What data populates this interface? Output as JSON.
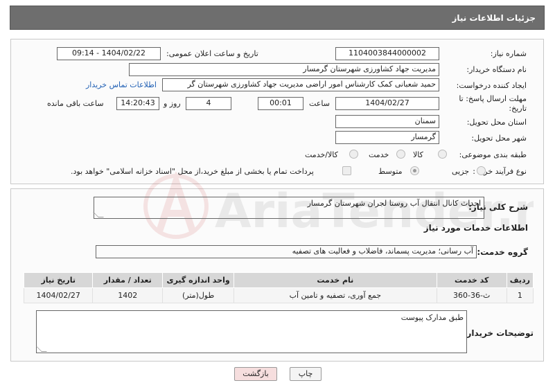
{
  "header": {
    "title": "جزئیات اطلاعات نیاز"
  },
  "form": {
    "need_number": {
      "label": "شماره نیاز:",
      "value": "1104003844000002"
    },
    "announce_datetime": {
      "label": "تاریخ و ساعت اعلان عمومی:",
      "value": "1404/02/22 - 09:14"
    },
    "buyer_org": {
      "label": "نام دستگاه خریدار:",
      "value": "مدیریت جهاد کشاورزی شهرستان گرمسار"
    },
    "requester": {
      "label": "ایجاد کننده درخواست:",
      "value": "حمید شعبانی کمک کارشناس امور اراضی مدیریت جهاد کشاورزی شهرستان گر",
      "contact_link": "اطلاعات تماس خریدار"
    },
    "deadline": {
      "label": "مهلت ارسال پاسخ: تا تاریخ:",
      "date": "1404/02/27",
      "time_label": "ساعت",
      "time": "00:01",
      "days": "4",
      "days_label": "روز و",
      "remaining": "14:20:43",
      "remaining_label": "ساعت باقی مانده"
    },
    "province": {
      "label": "استان محل تحویل:",
      "value": "سمنان"
    },
    "city": {
      "label": "شهر محل تحویل:",
      "value": "گرمسار"
    },
    "category": {
      "label": "طبقه بندی موضوعی:",
      "options": [
        {
          "label": "کالا",
          "selected": false
        },
        {
          "label": "خدمت",
          "selected": false
        },
        {
          "label": "کالا/خدمت",
          "selected": false
        }
      ]
    },
    "purchase_type": {
      "label": "نوع فرآیند خرید :",
      "options": [
        {
          "label": "جزیی",
          "selected": false
        },
        {
          "label": "متوسط",
          "selected": true
        }
      ],
      "payment_note": "پرداخت تمام یا بخشی از مبلغ خرید،از محل \"اسناد خزانه اسلامی\" خواهد بود."
    }
  },
  "details": {
    "general_desc_label": "شرح کلی نیاز:",
    "general_desc": "احداث کانال انتقال آب روستا لجران شهرستان گرمسار",
    "services_title": "اطلاعات خدمات مورد نیاز",
    "service_group_label": "گروه خدمت:",
    "service_group": "آب رسانی؛ مدیریت پسماند، فاضلاب و فعالیت های تصفیه",
    "table": {
      "headers": [
        "ردیف",
        "کد خدمت",
        "نام خدمت",
        "واحد اندازه گیری",
        "تعداد / مقدار",
        "تاریخ نیاز"
      ],
      "rows": [
        [
          "1",
          "ث-36-360",
          "جمع آوری، تصفیه و تامین آب",
          "طول(متر)",
          "1402",
          "1404/02/27"
        ]
      ]
    },
    "buyer_notes_label": "توضیحات خریدار:",
    "buyer_notes": "طبق مدارک پیوست"
  },
  "buttons": {
    "print": "چاپ",
    "back": "بازگشت"
  },
  "watermark": {
    "text": "AriaTender.neT"
  },
  "colors": {
    "header_bg": "#6e6e6e",
    "link": "#1f5fb4",
    "back_button": "#f6dede",
    "table_header": "#d7d7d7"
  }
}
